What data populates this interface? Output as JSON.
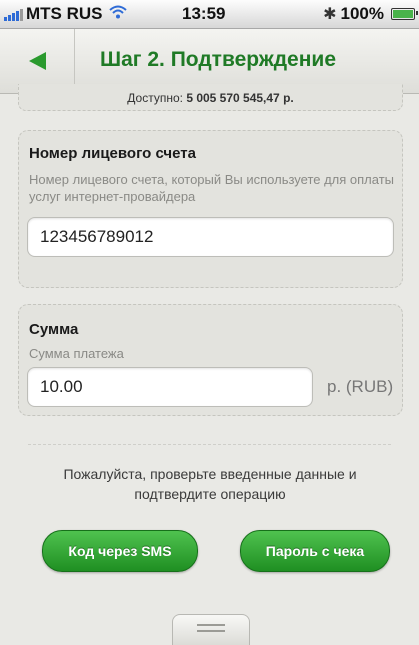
{
  "status_bar": {
    "carrier": "MTS RUS",
    "time": "13:59",
    "battery": "100%"
  },
  "navbar": {
    "title": "Шаг 2. Подтверждение"
  },
  "available": {
    "label": "Доступно:",
    "amount": "5 005 570 545,47 р."
  },
  "account": {
    "title": "Номер лицевого счета",
    "hint": "Номер лицевого счета, который Вы используете для оплаты услуг интернет-провайдера",
    "value": "123456789012"
  },
  "sum": {
    "title": "Сумма",
    "hint": "Сумма платежа",
    "value": "10.00",
    "unit": "р. (RUB)"
  },
  "confirm": {
    "message": "Пожалуйста, проверьте введенные данные и подтвердите операцию",
    "sms_button": "Код через SMS",
    "receipt_button": "Пароль с чека"
  },
  "colors": {
    "accent_green": "#1f7a26",
    "button_green": "#2fa82f"
  }
}
